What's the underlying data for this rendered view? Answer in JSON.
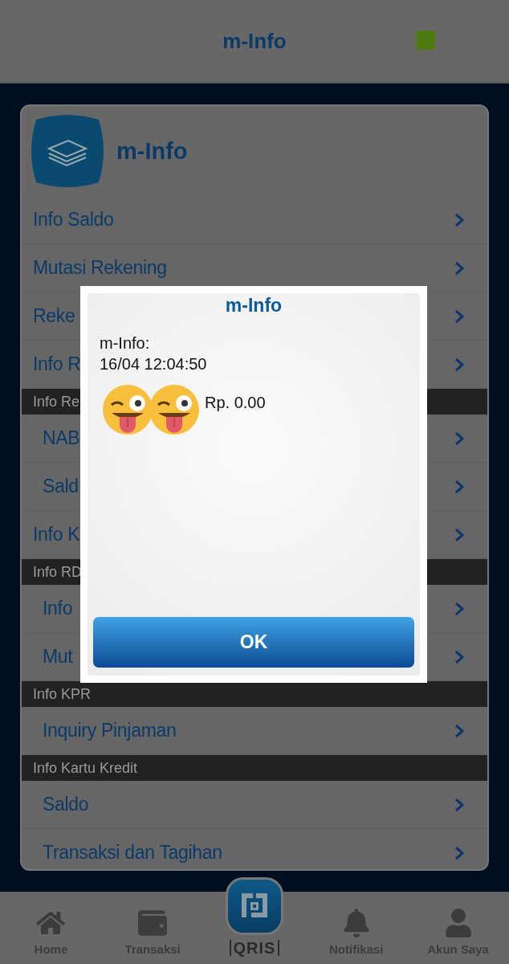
{
  "header": {
    "title": "m-Info"
  },
  "card": {
    "title": "m-Info"
  },
  "menu": [
    {
      "kind": "item",
      "label": "Info Saldo"
    },
    {
      "kind": "item",
      "label": "Mutasi Rekening"
    },
    {
      "kind": "item",
      "label": "Reke"
    },
    {
      "kind": "item",
      "label": "Info R"
    },
    {
      "kind": "section",
      "label": "Info Re"
    },
    {
      "kind": "subitem",
      "label": "NAB"
    },
    {
      "kind": "subitem",
      "label": "Sald"
    },
    {
      "kind": "item",
      "label": "Info K"
    },
    {
      "kind": "section",
      "label": "Info RD"
    },
    {
      "kind": "subitem",
      "label": "Info"
    },
    {
      "kind": "subitem",
      "label": "Mut"
    },
    {
      "kind": "section",
      "label": "Info KPR"
    },
    {
      "kind": "subitem",
      "label": "Inquiry Pinjaman"
    },
    {
      "kind": "section",
      "label": "Info Kartu Kredit"
    },
    {
      "kind": "subitem",
      "label": "Saldo"
    },
    {
      "kind": "subitem",
      "label": "Transaksi dan Tagihan"
    }
  ],
  "dialog": {
    "title": "m-Info",
    "lines": [
      "m-Info:",
      "16/04 12:04:50"
    ],
    "amount": "Rp. 0.00",
    "button": "OK"
  },
  "nav": [
    {
      "kind": "tab",
      "label": "Home"
    },
    {
      "kind": "tab",
      "label": "Transaksi"
    },
    {
      "kind": "center",
      "label": "QRIS"
    },
    {
      "kind": "tab",
      "label": "Notifikasi"
    },
    {
      "kind": "tab",
      "label": "Akun Saya"
    }
  ]
}
